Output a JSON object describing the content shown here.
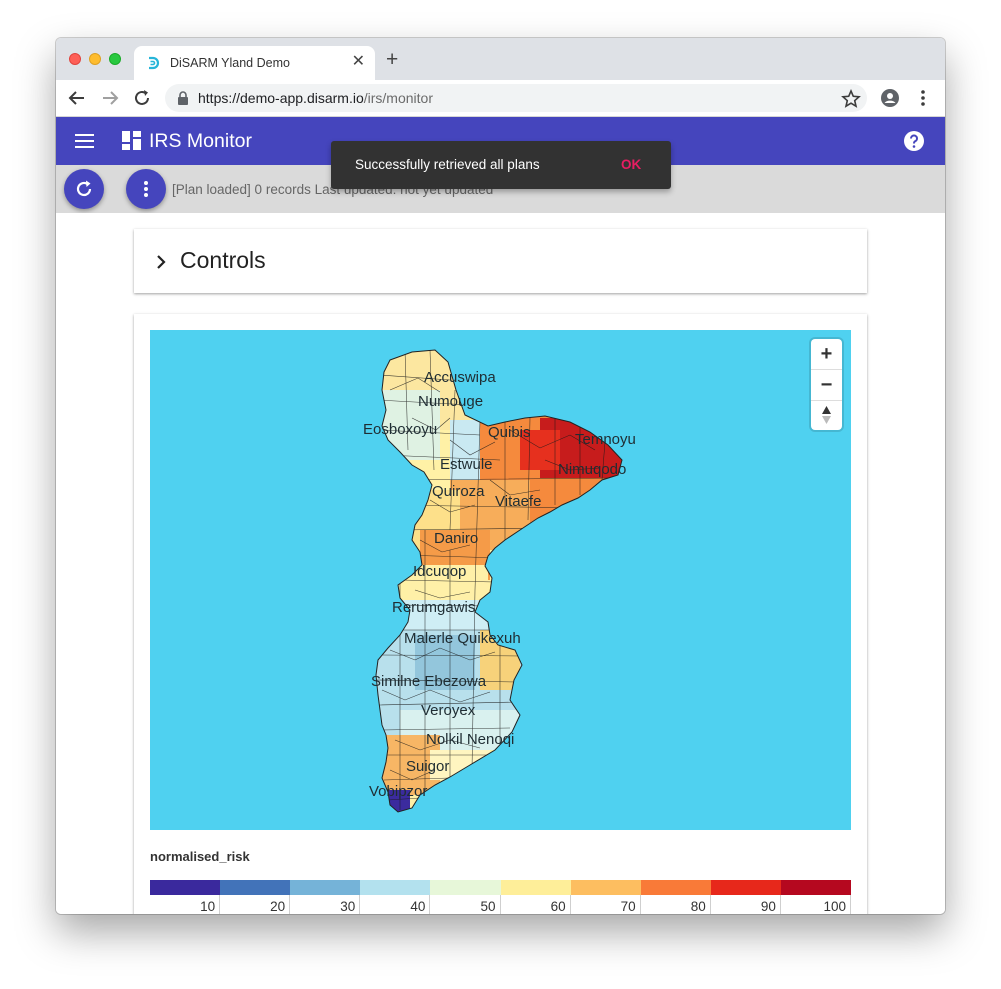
{
  "browser": {
    "tab_title": "DiSARM Yland Demo",
    "url_host": "https://demo-app.disarm.io",
    "url_path": "/irs/monitor"
  },
  "appbar": {
    "title": "IRS Monitor"
  },
  "subbar": {
    "status": "[Plan loaded] 0 records Last updated: not yet updated"
  },
  "snackbar": {
    "message": "Successfully retrieved all plans",
    "action": "OK"
  },
  "controls": {
    "label": "Controls"
  },
  "map": {
    "zoom_in": "+",
    "zoom_out": "−",
    "places": [
      "Accuswipa",
      "Numouge",
      "Eosboxoyu",
      "Quibis",
      "Temnoyu",
      "Nimuqodo",
      "Estwule",
      "Quiroza",
      "Vitaefe",
      "Daniro",
      "Idcuqop",
      "Rerumgawis",
      "Malerle Quikexuh",
      "Similne Ebezowa",
      "Veroyex",
      "Nolkil Nenoqi",
      "Suigor",
      "Vobipzor"
    ]
  },
  "legend": {
    "title": "normalised_risk",
    "labels": [
      "10",
      "20",
      "30",
      "40",
      "50",
      "60",
      "70",
      "80",
      "90",
      "100"
    ],
    "colors": [
      "#3a299d",
      "#4273b9",
      "#75b3d8",
      "#b3e1ee",
      "#e7f7d9",
      "#feee99",
      "#fdbe60",
      "#f97a38",
      "#e7281b",
      "#b5081f"
    ]
  }
}
